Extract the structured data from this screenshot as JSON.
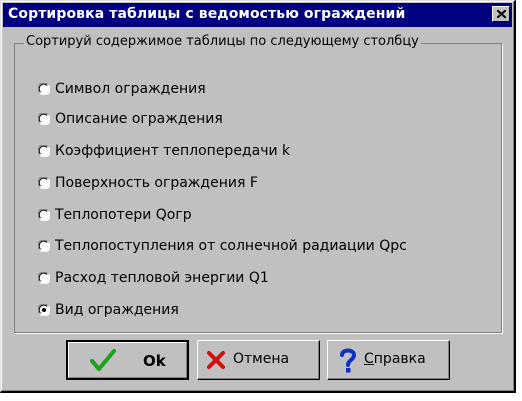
{
  "window": {
    "title": "Сортировка таблицы с ведомостью ограждений"
  },
  "group": {
    "legend": "Сортируй содержимое таблицы по следующему столбцу",
    "options": [
      {
        "label": "Символ ограждения",
        "selected": false
      },
      {
        "label": "Описание ограждения",
        "selected": false
      },
      {
        "label": "Коэффициент теплопередачи k",
        "selected": false
      },
      {
        "label": "Поверхность ограждения F",
        "selected": false
      },
      {
        "label": "Теплопотери Qогр",
        "selected": false
      },
      {
        "label": "Теплопоступления от солнечной радиации Qрс",
        "selected": false
      },
      {
        "label": "Расход тепловой энергии Q1",
        "selected": false
      },
      {
        "label": "Вид ограждения",
        "selected": true
      }
    ]
  },
  "buttons": {
    "ok_label": "Ok",
    "cancel_label": "Отмена",
    "help_label_first": "С",
    "help_label_rest": "правка"
  },
  "colors": {
    "titlebar": "#000080",
    "face": "#c0c0c0",
    "check_green": "#1aa01a",
    "cross_red": "#d01010",
    "help_blue": "#1030c0"
  }
}
